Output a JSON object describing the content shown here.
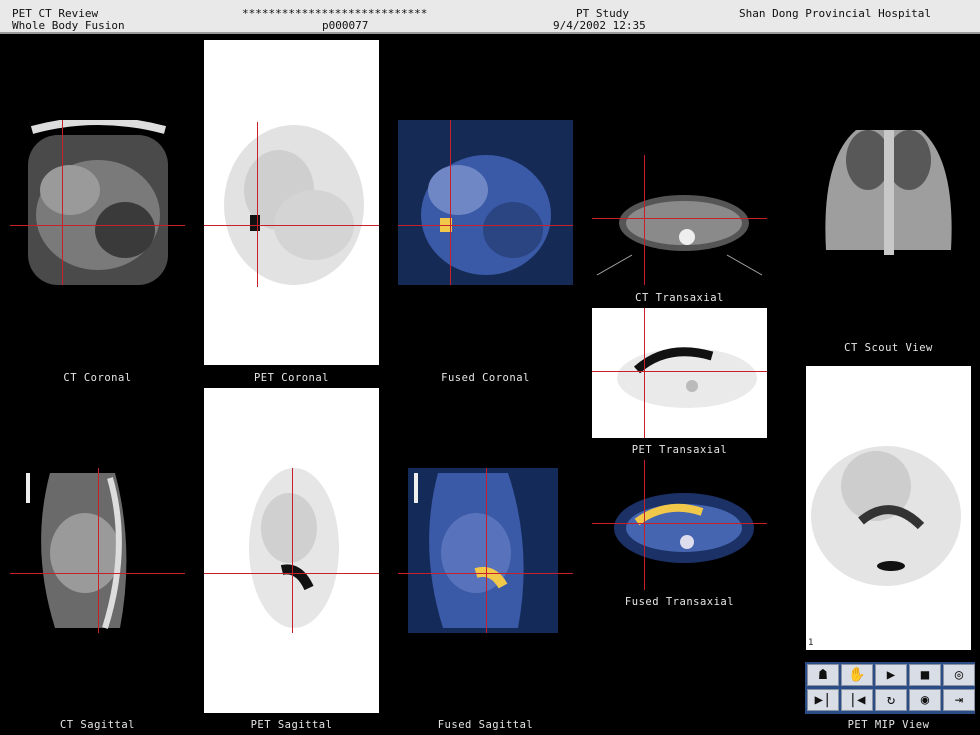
{
  "header": {
    "title_left": "PET CT Review",
    "subtitle_left": "Whole Body Fusion",
    "patient_name": "****************************",
    "patient_id": "p000077",
    "study": "PT Study",
    "datetime": "9/4/2002 12:35",
    "hospital": "Shan Dong Provincial Hospital"
  },
  "views": {
    "ct_coronal": "CT Coronal",
    "pet_coronal": "PET Coronal",
    "fused_coronal": "Fused Coronal",
    "ct_transaxial": "CT Transaxial",
    "ct_scout": "CT Scout View",
    "pet_transaxial": "PET Transaxial",
    "fused_transaxial": "Fused Transaxial",
    "ct_sagittal": "CT Sagittal",
    "pet_sagittal": "PET Sagittal",
    "fused_sagittal": "Fused Sagittal",
    "pet_mip": "PET MIP View"
  },
  "mip_index": "1",
  "colors": {
    "crosshair": "#c8202a",
    "toolbar_bg": "#2a4d85",
    "header_bg": "#e9e9e9"
  },
  "toolbar": {
    "buttons": [
      "anatomy-icon",
      "hand-icon",
      "play-icon",
      "stop-icon",
      "target-icon",
      "skip-end-icon",
      "skip-start-icon",
      "rotate-icon",
      "spiral-icon",
      "export-icon"
    ]
  }
}
